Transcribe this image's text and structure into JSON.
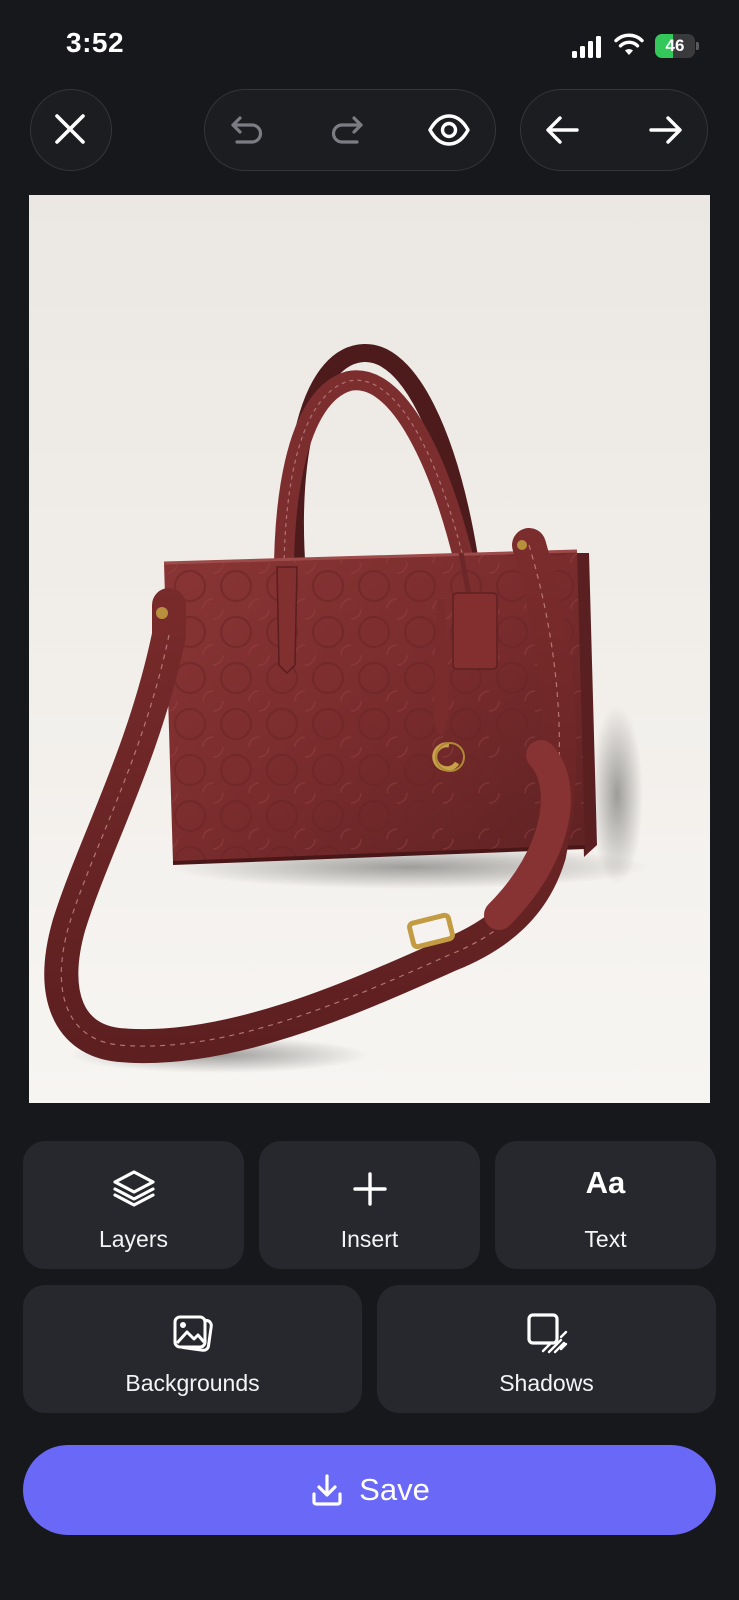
{
  "status_bar": {
    "time": "3:52",
    "battery_level": "46",
    "battery_fraction": 0.46,
    "charging": true
  },
  "toolbar": {
    "close_icon": "close-icon",
    "undo_icon": "undo-icon",
    "redo_icon": "redo-icon",
    "preview_icon": "eye-icon",
    "back_icon": "arrow-left-icon",
    "forward_icon": "arrow-right-icon"
  },
  "tools": {
    "layers": {
      "label": "Layers",
      "icon": "layers-icon"
    },
    "insert": {
      "label": "Insert",
      "icon": "plus-icon"
    },
    "text": {
      "label": "Text",
      "glyph": "Aa"
    },
    "backgrounds": {
      "label": "Backgrounds",
      "icon": "images-icon"
    },
    "shadows": {
      "label": "Shadows",
      "icon": "shadow-square-icon"
    }
  },
  "save": {
    "label": "Save",
    "icon": "download-icon"
  },
  "colors": {
    "background": "#17181b",
    "tile": "#26282d",
    "accent": "#6a68f6",
    "battery": "#34c759",
    "bag": "#7a2e2e"
  }
}
